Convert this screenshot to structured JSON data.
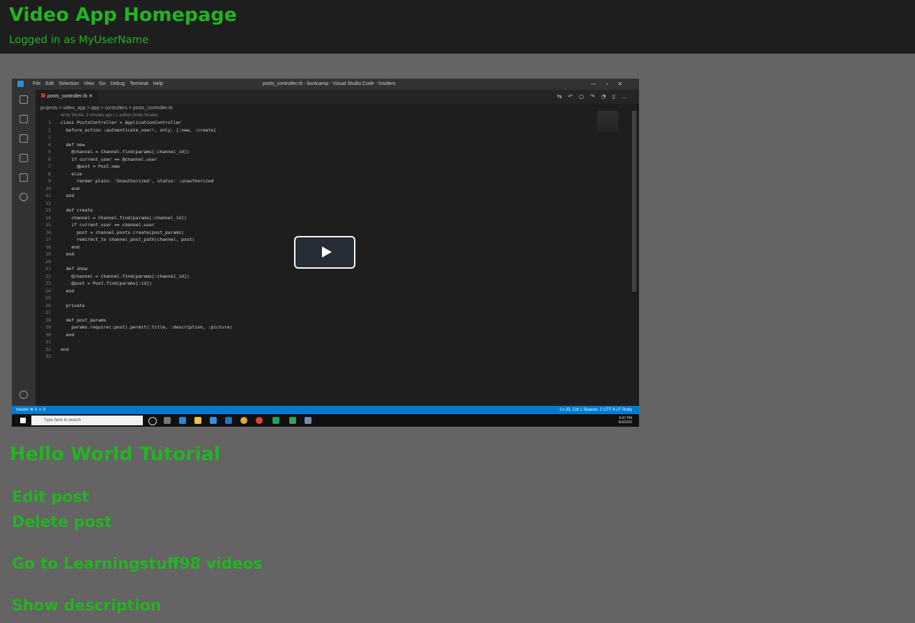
{
  "header": {
    "title": "Video App Homepage",
    "logged_in": "Logged in as MyUserName"
  },
  "video": {
    "window_title": "posts_controller.rb - bootcamp - Visual Studio Code - Insiders",
    "menu": [
      "File",
      "Edit",
      "Selection",
      "View",
      "Go",
      "Debug",
      "Terminal",
      "Help"
    ],
    "tab": "posts_controller.rb",
    "breadcrumb": "projects > video_app > app > controllers > posts_controller.rb",
    "blame": "Andy Strube, 2 minutes ago | 1 author (Andy Strube)",
    "code_lines": [
      "class PostsController < ApplicationController",
      "  before_action :authenticate_user!, only: [:new, :create]",
      "",
      "  def new",
      "    @channel = Channel.find(params[:channel_id])",
      "    if current_user == @channel.user",
      "      @post = Post.new",
      "    else",
      "      render plain: 'Unauthorized', status: :unauthorized",
      "    end",
      "  end",
      "",
      "  def create",
      "    channel = Channel.find(params[:channel_id])",
      "    if current_user == channel.user",
      "      post = channel.posts.create(post_params)",
      "      redirect_to channel_post_path(channel, post)",
      "    end",
      "  end",
      "",
      "  def show",
      "    @channel = Channel.find(params[:channel_id])",
      "    @post = Post.find(params[:id])",
      "  end",
      "",
      "  private",
      "",
      "  def post_params",
      "    params.require(:post).permit(:title, :description, :picture)",
      "  end",
      "",
      "end",
      ""
    ],
    "status_left": "master   ⊗ 0  ⚠ 0",
    "status_right": "Ln 33, Col 1    Spaces: 2    UTF-8    LF    Ruby",
    "taskbar_search": "Type here to search",
    "clock_time": "6:47 PM",
    "clock_date": "6/9/2020"
  },
  "post": {
    "title": "Hello World Tutorial"
  },
  "links": {
    "edit": "Edit post",
    "delete": "Delete post",
    "channel": "Go to Learningstuff98 videos",
    "description": "Show description"
  }
}
